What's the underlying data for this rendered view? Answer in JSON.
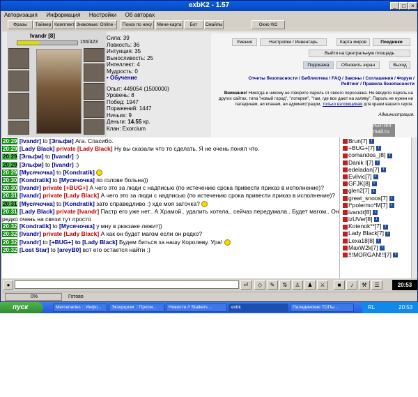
{
  "window": {
    "title": "exbK2 - 1.57"
  },
  "menu": [
    "Авторизация",
    "Информация",
    "Настройки",
    "Об авторах"
  ],
  "toolbar": [
    "Фразы",
    "Таймер",
    "Комплект",
    "Знакомые: Online -",
    "Поиск по нику",
    "Мини-карта",
    "Бот",
    "Смайлы",
    "Окно W2"
  ],
  "character": {
    "name": "Ivandr",
    "level": "[8]",
    "hp": "155/423",
    "hp_fraction": 0.366,
    "stats": [
      "Сила: 39",
      "Ловкость: 36",
      "Интуиция: 35",
      "Выносливость: 25",
      "Интеллект: 4",
      "Мудрость: 0"
    ],
    "training": "• Обучение",
    "info": [
      "Опыт: 449054 (1500000)",
      "Уровень: 8",
      "Побед: 1947",
      "Поражений: 1447",
      "Ничьих: 9"
    ],
    "money_label": "Деньги:",
    "money": "14.55",
    "money_unit": "кр.",
    "clan": "Клан: Exorcium"
  },
  "right_panel": {
    "buttons_top": [
      "Умения",
      "Настройки / Инвентарь",
      "Карта миров",
      "Поединки"
    ],
    "exit_button": "Выйти на Центральную площадь",
    "hint_button": "Подсказка",
    "refresh_button": "Обновить экран",
    "quit_button": "Выход",
    "links_line1": "Отчеты безопасности / Библиотека / FAQ / Законы / Соглашения / Форум /",
    "links_line2": "Рейтинг / Правила безопасности",
    "warning_bold": "Внимание!",
    "warning_text": " Никогда и никому не говорите пароль от своего персонажа. Не вводите пароль на других сайтах, типа \"новый город\", \"лотерея\", \"там, где все дают на халяву\". Пароль не нужен ни паладинам, ни кланам, ни администрации,",
    "warning_link": "только взломщикам",
    "warning_end": " для кражи вашего героя.",
    "administration": "Администрация.",
    "counter_label": "РЕЙТИНГ",
    "counter_site": "mail.ru"
  },
  "chat": [
    {
      "t": "20:29",
      "n": "[Ivandr]",
      "k": "to",
      "r": "[Эльфи]",
      "m": "Ага. Спасибо."
    },
    {
      "t": "20:29",
      "n": "[Lady Black]",
      "k": "private",
      "r": "[Lady Black]",
      "m": "Ну вы сказали что то сделать. Я не очень понял что."
    },
    {
      "t": "20:29",
      "g": true,
      "n": "[Эльфи]",
      "k": "to",
      "r": "[Ivandr]",
      "m": ":)"
    },
    {
      "t": "20:29",
      "g": true,
      "n": "[Эльфи]",
      "k": "to",
      "r": "[Ivandr]",
      "m": ":)"
    },
    {
      "t": "20:29",
      "n": "[Мусячочка]",
      "k": "to",
      "r": "[Kondratik]",
      "m": "",
      "e": true
    },
    {
      "t": "20:30",
      "n": "[Kondratik]",
      "k": "to",
      "r": "[Мусячочка]",
      "m": "по голове больна))"
    },
    {
      "t": "20:30",
      "n": "[Ivandr]",
      "k": "private",
      "r": "[+BUG+]",
      "m": "А чего это за люди с надписью (по истечению срока привести приказ в исполнение)?"
    },
    {
      "t": "20:31",
      "n": "[Ivandr]",
      "k": "private",
      "r": "[Lady Black]",
      "m": "А чего это за люди с надписью (по истечению срока привести приказ в исполнение)?"
    },
    {
      "t": "20:31",
      "g": true,
      "n": "[Мусячочка]",
      "k": "to",
      "r": "[Kondratik]",
      "m": "зато справедливо :) хде моя заточка?",
      "e": true
    },
    {
      "t": "20:31",
      "n": "[Lady Black]",
      "k": "private",
      "r": "[Ivandr]",
      "m": "Пастр его уже нет.. А Храмой.. удалить хотела.. сейчаз передумала.. Будет магом.. Он редко очень на связи тут просто"
    },
    {
      "t": "20:32",
      "n": "[Kondratik]",
      "k": "to",
      "r": "[Мусячочка]",
      "m": "у мну в рюкзаке лежит))"
    },
    {
      "t": "20:32",
      "n": "[Ivandr]",
      "k": "private",
      "r": "[Lady Black]",
      "m": "А как он будет магом если он редко?"
    },
    {
      "t": "20:32",
      "n": "[Ivandr]",
      "k": "to",
      "r": "[+BUG+] to [Lady Black]",
      "m": "Будем биться за нашу Королеву. Ура!",
      "e": true
    },
    {
      "t": "20:32",
      "n": "[Lost Star]",
      "k": "to",
      "r": "[areyB0]",
      "m": "вот его остается найти :)"
    }
  ],
  "users": [
    "Brun[7]",
    "+BUG+[7]",
    "comandos_[8]",
    "Danik I[7]",
    "edeladan[7]",
    "Evilvic[7]",
    "GFJK[8]",
    "glen2[7]",
    "great_snoos[7]",
    "I*polermo*M[7]",
    "ivandr[8]",
    "izUVer[8]",
    "Kotenok**[7]",
    "Lady Black[7]",
    "Lexa18[8]",
    "MaxW2k[7]",
    "!!!MORGAN!!![7]"
  ],
  "status": {
    "progress": "0%",
    "text": "Готово",
    "clock": "20:53"
  },
  "taskbar": {
    "start": "пуск",
    "tasks": [
      "Mercenaries :: Инфо...",
      "Экзорцизм :: Просм...",
      "Новости // Stalkers ...",
      "exbk",
      "Паладинские ТОПы..."
    ],
    "tray_lang": "RL",
    "tray_time": "20:53"
  }
}
